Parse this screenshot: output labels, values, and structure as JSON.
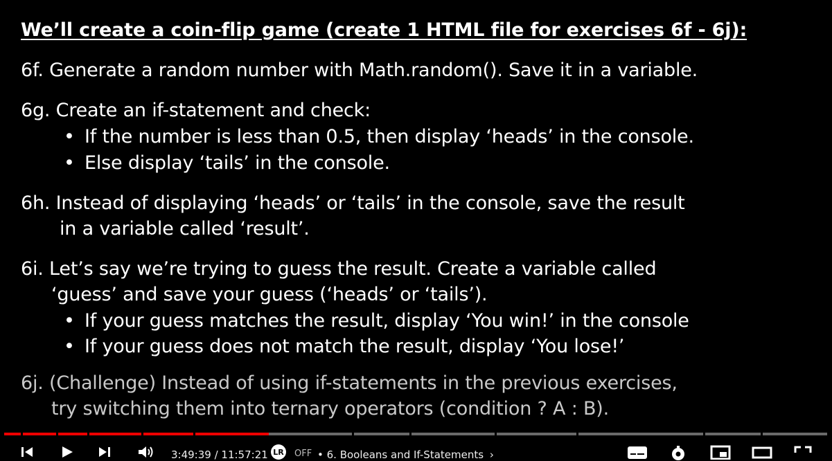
{
  "slide": {
    "title": "We’ll create a coin-flip game (create 1 HTML file for exercises 6f - 6j):",
    "f": "6f. Generate a random number with Math.random(). Save it in a variable.",
    "g": "6g. Create an if-statement and check:",
    "g_b1": "If the number is less than 0.5, then display ‘heads’ in the console.",
    "g_b2": "Else display ‘tails’ in the console.",
    "h1": "6h. Instead of displaying ‘heads’ or ‘tails’ in the console, save the result",
    "h2": "in a variable called ‘result’.",
    "i1": "6i. Let’s say we’re trying to guess the result. Create a variable called",
    "i2": "‘guess’ and save your guess (‘heads’ or ‘tails’).",
    "i_b1": "If your guess matches the result, display ‘You win!’ in the console",
    "i_b2": "If your guess does not match the result, display ‘You lose!’",
    "j1": "6j. (Challenge) Instead of using if-statements in the previous exercises,",
    "j2": "try switching them into ternary operators (condition ? A : B).",
    "bullet": "•"
  },
  "player": {
    "time": "3:49:39 / 11:57:21",
    "autoplay_state": "OFF",
    "chapter": "• 6. Booleans and If-Statements",
    "chapter_chevron": "›",
    "progress_fraction": 0.32,
    "played_color": "#ff0000",
    "icons": [
      "previous-icon",
      "play-icon",
      "next-icon",
      "volume-icon",
      "autoplay-toggle-icon",
      "subtitles-icon",
      "settings-icon",
      "miniplayer-icon",
      "theater-icon",
      "fullscreen-icon"
    ]
  }
}
